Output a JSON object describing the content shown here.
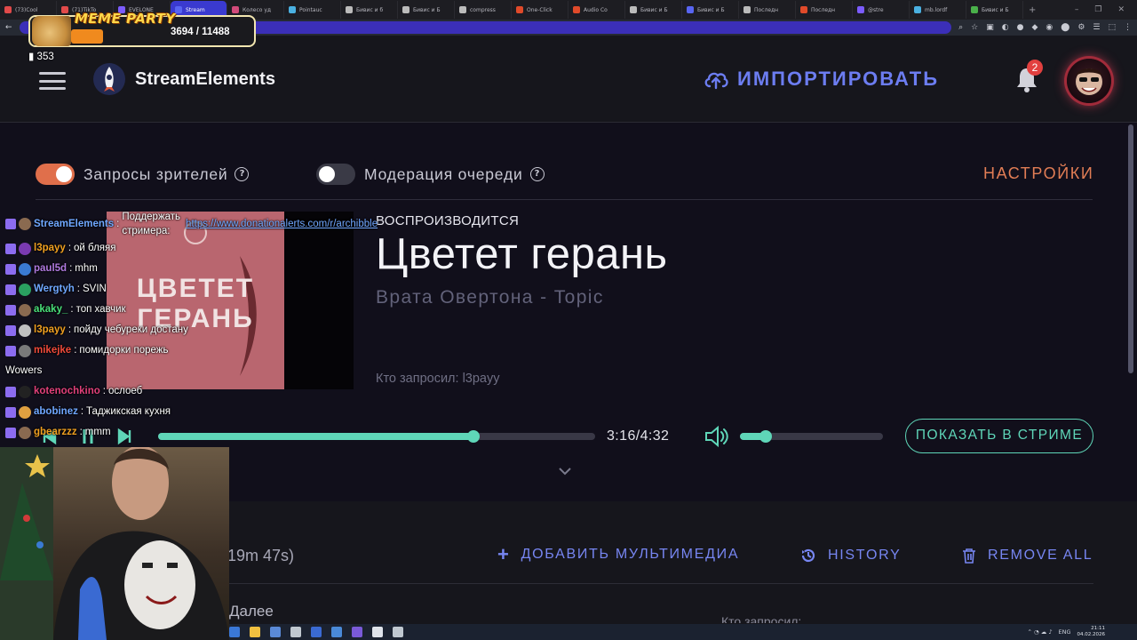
{
  "browser": {
    "tabs": [
      {
        "label": "(73)Cool",
        "color": "#e14a4a",
        "active": false
      },
      {
        "label": "(71)TikTo",
        "color": "#e14a4a",
        "active": false
      },
      {
        "label": "EVELONE",
        "color": "#7c5cff",
        "active": false
      },
      {
        "label": "Stream",
        "color": "#5865f2",
        "active": true
      },
      {
        "label": "Колесо уд",
        "color": "#d14a7a",
        "active": false
      },
      {
        "label": "Pointauc",
        "color": "#4ab0e1",
        "active": false
      },
      {
        "label": "Бивис и б",
        "color": "#bbbbbb",
        "active": false
      },
      {
        "label": "Бивис и Б",
        "color": "#bbbbbb",
        "active": false
      },
      {
        "label": "compress",
        "color": "#bbbbbb",
        "active": false
      },
      {
        "label": "One-Click",
        "color": "#e04a2a",
        "active": false
      },
      {
        "label": "Audio Co",
        "color": "#e04a2a",
        "active": false
      },
      {
        "label": "Бивис и Б",
        "color": "#bbbbbb",
        "active": false
      },
      {
        "label": "Бивис и Б",
        "color": "#5865f2",
        "active": false
      },
      {
        "label": "Последн",
        "color": "#bbbbbb",
        "active": false
      },
      {
        "label": "Последн",
        "color": "#e04a2a",
        "active": false
      },
      {
        "label": "@stre",
        "color": "#7c5cff",
        "active": false
      },
      {
        "label": "mb.lordf",
        "color": "#4ab0e1",
        "active": false
      },
      {
        "label": "Бивис и Б",
        "color": "#4ab04a",
        "active": false
      }
    ],
    "new_tab": "+",
    "window_controls": [
      "–",
      "❐",
      "✕"
    ],
    "extensions": [
      "⌕",
      "☆",
      "▣",
      "◐",
      "●",
      "◆",
      "◉",
      "⬤",
      "⚙",
      "☰",
      "⬚",
      "⋮"
    ]
  },
  "header": {
    "brand": "StreamElements",
    "import_label": "ИМПОРТИРОВАТЬ",
    "notifications_count": "2"
  },
  "toggles": {
    "viewer_requests": {
      "label": "Запросы зрителей",
      "on": true
    },
    "queue_moderation": {
      "label": "Модерация очереди",
      "on": false
    },
    "help": "?"
  },
  "settings_label": "НАСТРОЙКИ",
  "now_playing": {
    "status": "ВОСПРОИЗВОДИТСЯ",
    "title": "Цветет герань",
    "artist": "Врата Овертона - Topic",
    "requested_by": "Кто запросил: l3payy",
    "thumbnail_text": "ЦВЕТЕТ ГЕРАНЬ",
    "time": "3:16/4:32",
    "progress": 0.7206,
    "volume": 0.18
  },
  "show_button": "ПОКАЗАТЬ В СТРИМЕ",
  "queue": {
    "duration": "19m 47s)",
    "add_media": "ДОБАВИТЬ МУЛЬТИМЕДИА",
    "history": "HISTORY",
    "remove_all": "REMOVE ALL",
    "next_label": "Далее",
    "requested_label": "Кто запросил:"
  },
  "overlay": {
    "meme_title": "MEME PARTY",
    "meme_count": "3694 / 11488",
    "viewers": "353",
    "chat": [
      {
        "nick": "StreamElements",
        "color": "#6fa7ff",
        "message": "Поддержать стримера:",
        "link": "https://www.donationalerts.com/r/archibble"
      },
      {
        "nick": "l3payy",
        "color": "#f0a020",
        "message": "ой бляяя"
      },
      {
        "nick": "paul5d",
        "color": "#b07ae0",
        "message": "mhm"
      },
      {
        "nick": "Wergtyh",
        "color": "#6fa7ff",
        "message": "SVIN"
      },
      {
        "nick": "akaky_",
        "color": "#4ae07a",
        "message": "топ хавчик"
      },
      {
        "nick": "l3payy",
        "color": "#f0a020",
        "message": "пойду чебуреки достану"
      },
      {
        "nick": "mikejke",
        "color": "#f04a3a",
        "message": "помидорки порежь"
      },
      {
        "nick": "",
        "color": "#ffffff",
        "message": "Wowers"
      },
      {
        "nick": "kotenochkino",
        "color": "#e0407a",
        "message": "ослоеб"
      },
      {
        "nick": "abobinez",
        "color": "#6fa7ff",
        "message": "Таджикская кухня"
      },
      {
        "nick": "gbearzzz",
        "color": "#f0a020",
        "message": "mmm"
      }
    ]
  },
  "taskbar": {
    "language": "ENG",
    "time": "21:11",
    "date": "04.02.2026"
  },
  "colors": {
    "accent_orange": "#e06f4b",
    "accent_teal": "#5fd6b8",
    "accent_blue": "#6c7df1",
    "background": "#110f1b"
  }
}
